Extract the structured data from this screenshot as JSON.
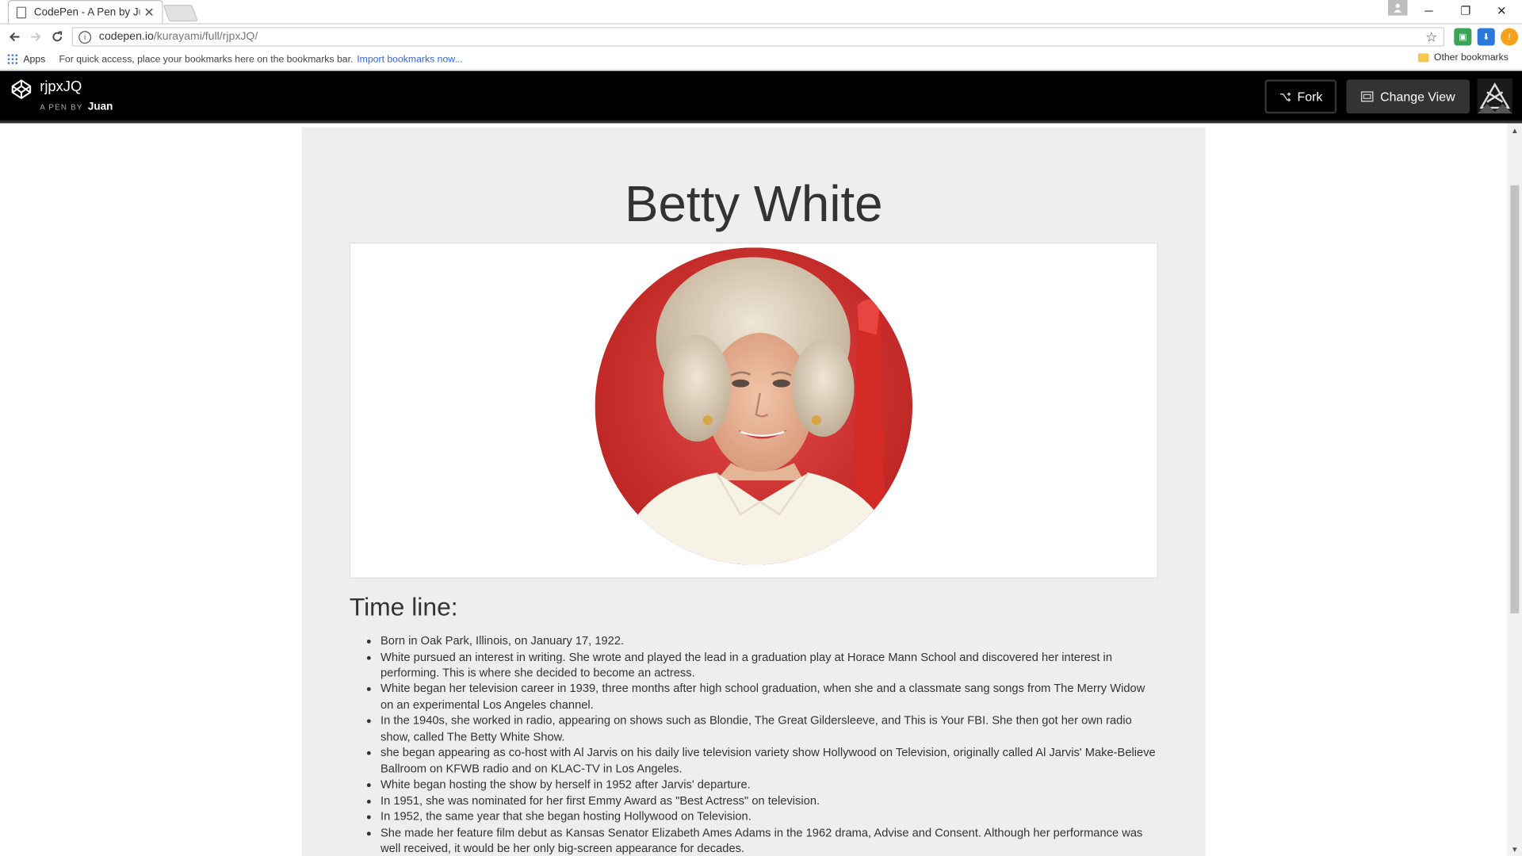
{
  "browser": {
    "tab_title": "CodePen - A Pen by Juan",
    "tab_close": "✕",
    "window_controls": {
      "minimize": "─",
      "restore": "❐",
      "close": "✕"
    },
    "url_host": "codepen.io",
    "url_path": "/kurayami/full/rjpxJQ/",
    "bookmarks": {
      "apps_label": "Apps",
      "hint": "For quick access, place your bookmarks here on the bookmarks bar.",
      "import_link": "Import bookmarks now...",
      "other": "Other bookmarks"
    }
  },
  "codepen": {
    "pen_title": "rjpxJQ",
    "by_label": "A PEN BY",
    "author": "Juan",
    "fork_label": "Fork",
    "change_view_label": "Change View"
  },
  "page": {
    "heading": "Betty White",
    "timeline_title": "Time line:",
    "timeline": [
      "Born in Oak Park, Illinois, on January 17, 1922.",
      "White pursued an interest in writing. She wrote and played the lead in a graduation play at Horace Mann School and discovered her interest in performing. This is where she decided to become an actress.",
      "White began her television career in 1939, three months after high school graduation, when she and a classmate sang songs from The Merry Widow on an experimental Los Angeles channel.",
      "In the 1940s, she worked in radio, appearing on shows such as Blondie, The Great Gildersleeve, and This is Your FBI. She then got her own radio show, called The Betty White Show.",
      "she began appearing as co-host with Al Jarvis on his daily live television variety show Hollywood on Television, originally called Al Jarvis' Make-Believe Ballroom on KFWB radio and on KLAC-TV in Los Angeles.",
      "White began hosting the show by herself in 1952 after Jarvis' departure.",
      "In 1951, she was nominated for her first Emmy Award as \"Best Actress\" on television.",
      "In 1952, the same year that she began hosting Hollywood on Television.",
      "She made her feature film debut as Kansas Senator Elizabeth Ames Adams in the 1962 drama, Advise and Consent. Although her performance was well received, it would be her only big-screen appearance for decades."
    ]
  }
}
